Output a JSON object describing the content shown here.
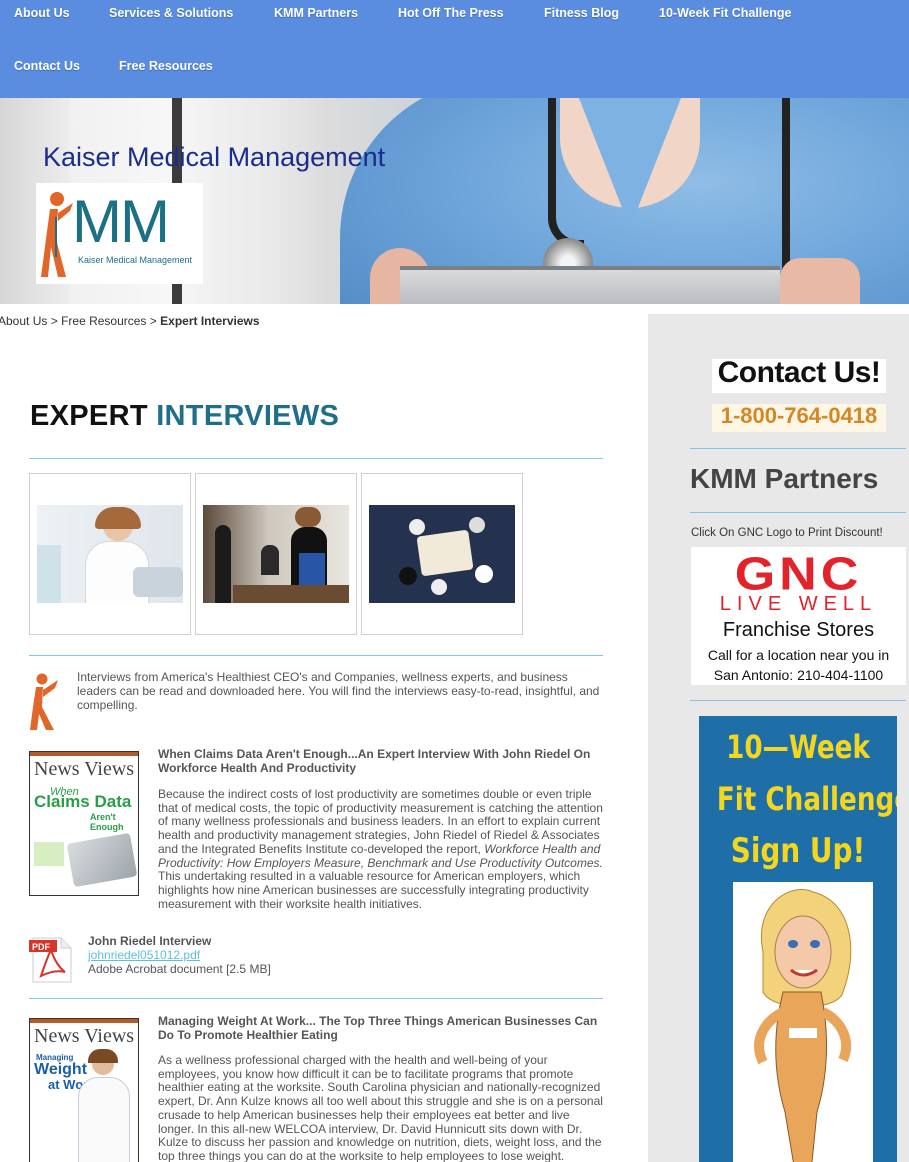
{
  "nav": {
    "row1": [
      "About Us",
      "Services & Solutions",
      "KMM Partners",
      "Hot Off The Press",
      "Fitness Blog",
      "10-Week Fit Challenge"
    ],
    "row2": [
      "Contact Us",
      "Free Resources"
    ]
  },
  "header": {
    "site_title": "Kaiser Medical Management",
    "logo_letters": "MM",
    "logo_caption": "Kaiser Medical Management"
  },
  "breadcrumb": {
    "items": [
      "About Us",
      "Free Resources"
    ],
    "separator": ">",
    "current": "Expert Interviews"
  },
  "main": {
    "heading_part1": "EXPERT",
    "heading_part2": "INTERVIEWS",
    "intro": "Interviews from America's Healthiest CEO's and Companies, wellness experts, and business leaders can be read and downloaded here.  You will find the interviews easy-to-read, insightful, and compelling.",
    "articles": [
      {
        "title": "When Claims Data Aren't Enough...An Expert Interview With John Riedel On Workforce Health And Productivity",
        "body_1": "Because the indirect costs of lost productivity are sometimes double or even triple that of medical costs, the topic of productivity measurement is catching the attention of many wellness professionals and business leaders. In an effort to explain current health and productivity management strategies, John Riedel of Riedel & Associates and the Integrated Benefits Institute co-developed the report, ",
        "body_italic": "Workforce Health and Productivity: How Employers Measure, Benchmark and Use Productivity Outcomes.",
        "body_2": " This undertaking resulted in a valuable resource for American employers, which highlights how nine American businesses are successfully integrating productivity measurement with their worksite health initiatives.",
        "cover": {
          "mast_1": "News",
          "mast_2": "Views",
          "line_1": "When",
          "line_2": "Claims Data",
          "line_3": "Aren't Enough"
        }
      },
      {
        "title": "Managing Weight At Work... The Top Three Things American Businesses Can Do To Promote Healthier Eating",
        "body_1": "As a wellness professional charged with the health and well-being of your employees, you know how difficult it can be to facilitate programs that promote healthier eating at the worksite. South Carolina physician and nationally-recognized expert, Dr. Ann Kulze knows all too well about this struggle and she is on a personal crusade to help American businesses help their employees eat better and live longer. In this all-new WELCOA interview, Dr. David Hunnicutt sits down with Dr. Kulze to discuss her passion and knowledge on nutrition, diets, weight loss, and the top three things you can do at the worksite to help employees to lose weight.",
        "cover": {
          "mast_1": "News",
          "mast_2": "Views",
          "line_1": "Managing",
          "line_2": "Weight",
          "line_3": "at Work"
        }
      }
    ],
    "download": {
      "name": "John Riedel Interview",
      "file": "johnriedel051012.pdf",
      "meta": "Adobe Acrobat document [2.5 MB]",
      "icon_label": "PDF"
    }
  },
  "sidebar": {
    "contact_heading": "Contact Us!",
    "phone": "1-800-764-0418",
    "partners_heading": "KMM Partners",
    "gnc_note": "Click On GNC Logo to Print Discount!",
    "gnc": {
      "logo": "GNC",
      "tagline": "LIVE WELL",
      "franchise": "Franchise Stores",
      "call": "Call for a location near you in",
      "city_phone": "San Antonio: 210-404-1100"
    },
    "fit": {
      "line1": "10—Week",
      "line2": "Fit Challenge",
      "line3": "Sign Up!"
    }
  },
  "colors": {
    "nav_bg": "#5a8de0",
    "accent_teal": "#1f6f8b",
    "rule": "#7fc7e3",
    "phone_orange": "#d58726",
    "gnc_red": "#e2232a",
    "fit_blue": "#1e6fa8",
    "fit_yellow": "#f5d61e"
  }
}
